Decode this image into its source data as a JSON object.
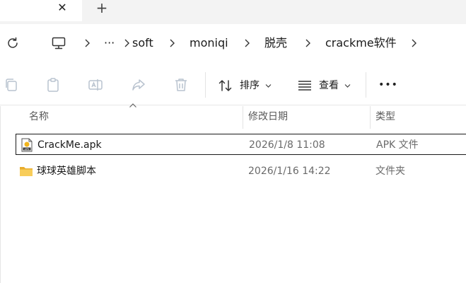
{
  "tabs": {
    "close_glyph": "✕",
    "new_tab_glyph": "+"
  },
  "breadcrumb": {
    "more": "···",
    "items": [
      "soft",
      "moniqi",
      "脱壳",
      "crackme软件"
    ]
  },
  "toolbar": {
    "sort_label": "排序",
    "view_label": "查看",
    "more_glyph": "•••"
  },
  "columns": {
    "name": "名称",
    "date": "修改日期",
    "type": "类型"
  },
  "files": [
    {
      "name": "CrackMe.apk",
      "date": "2026/1/8 11:08",
      "type": "APK 文件",
      "icon": "apk-file-icon"
    },
    {
      "name": "球球英雄脚本",
      "date": "2026/1/16 14:22",
      "type": "文件夹",
      "icon": "folder-icon"
    }
  ],
  "colors": {
    "accent": "#0067c0",
    "folder": "#f5c64f",
    "selection_border": "#1a1a1a"
  }
}
